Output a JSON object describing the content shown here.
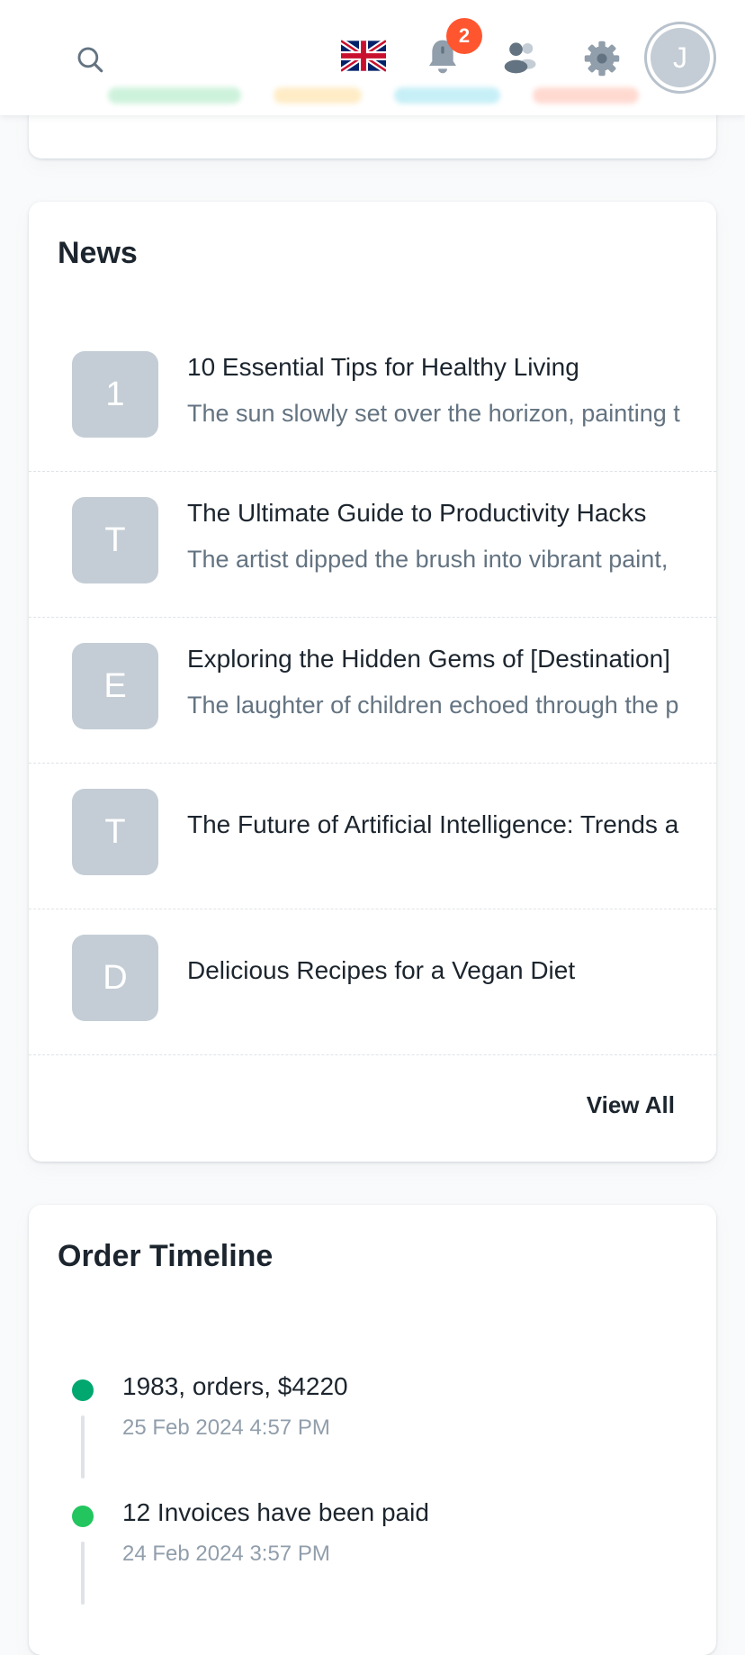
{
  "header": {
    "icons": {
      "search": "search-icon",
      "language": "uk-flag-icon",
      "notifications": "bell-icon",
      "contacts": "contacts-icon",
      "settings": "gear-icon"
    },
    "notification_count": "2",
    "avatar_initial": "J"
  },
  "news": {
    "title": "News",
    "items": [
      {
        "thumb": "1",
        "title": "10 Essential Tips for Healthy Living",
        "description": "The sun slowly set over the horizon, painting t"
      },
      {
        "thumb": "T",
        "title": "The Ultimate Guide to Productivity Hacks",
        "description": "The artist dipped the brush into vibrant paint,"
      },
      {
        "thumb": "E",
        "title": "Exploring the Hidden Gems of [Destination]",
        "description": "The laughter of children echoed through the p"
      },
      {
        "thumb": "T",
        "title": "The Future of Artificial Intelligence: Trends a",
        "description": ""
      },
      {
        "thumb": "D",
        "title": "Delicious Recipes for a Vegan Diet",
        "description": ""
      }
    ],
    "view_all_label": "View All"
  },
  "timeline": {
    "title": "Order Timeline",
    "items": [
      {
        "title": "1983, orders, $4220",
        "time": "25 Feb 2024 4:57 PM",
        "color": "#00a76f"
      },
      {
        "title": "12 Invoices have been paid",
        "time": "24 Feb 2024 3:57 PM",
        "color": "#22c55e"
      }
    ]
  },
  "colors": {
    "accent": "#00a76f",
    "badge": "#ff5630",
    "thumb": "#c4cdd5"
  }
}
